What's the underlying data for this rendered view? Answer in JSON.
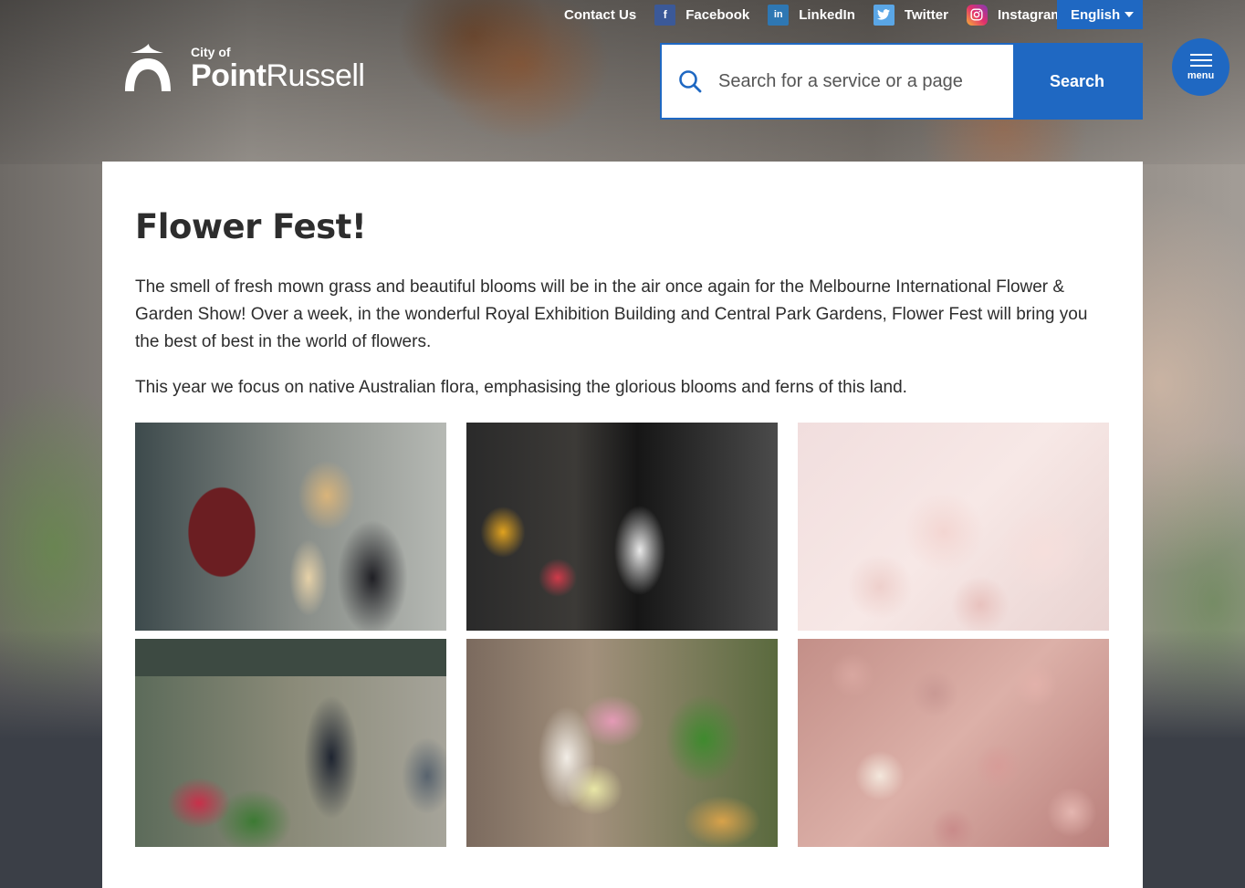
{
  "utility_nav": {
    "contact": "Contact Us",
    "facebook": "Facebook",
    "linkedin": "LinkedIn",
    "twitter": "Twitter",
    "instagram": "Instagram",
    "language": "English"
  },
  "logo": {
    "city_of": "City of",
    "name_bold": "Point",
    "name_light": "Russell"
  },
  "search": {
    "placeholder": "Search for a service or a page",
    "button_label": "Search"
  },
  "menu": {
    "label": "menu"
  },
  "article": {
    "title": "Flower Fest!",
    "paragraphs": [
      "The smell of fresh mown grass and beautiful blooms will be in the air once again for the Melbourne International Flower & Garden Show! Over a week, in the wonderful Royal Exhibition Building and Central Park Gardens, Flower Fest will bring you the best of best in the world of flowers.",
      "This year we focus on native Australian flora, emphasising the glorious blooms and ferns of this land."
    ]
  },
  "colors": {
    "brand_blue": "#1f68c2",
    "text": "#2d2d2d"
  }
}
